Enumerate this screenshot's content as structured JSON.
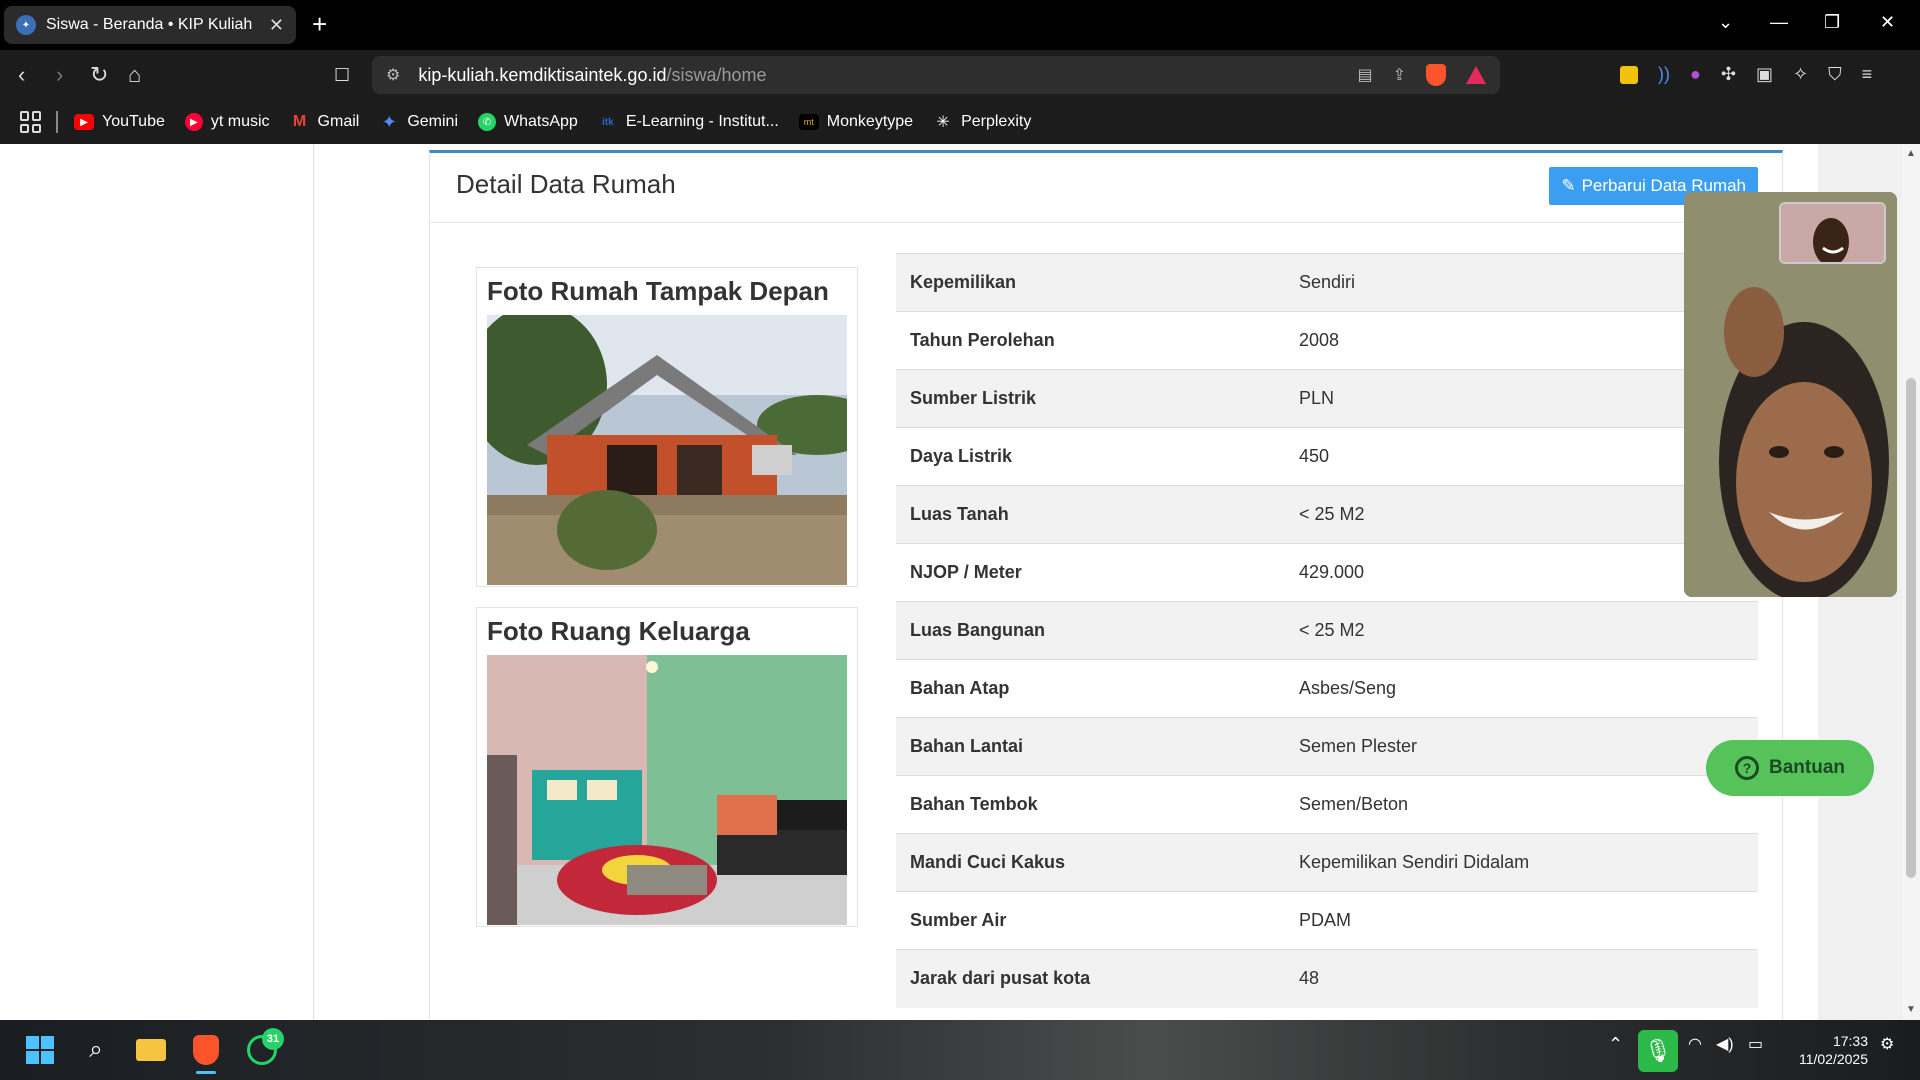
{
  "browser": {
    "tab": {
      "title": "Siswa - Beranda • KIP Kuliah",
      "close": "✕"
    },
    "new_tab": "+",
    "url_host": "kip-kuliah.kemdiktisaintek.go.id",
    "url_path": "/siswa/home",
    "bookmarks": [
      {
        "label": "YouTube",
        "icon": "youtube-icon",
        "color": "#ff0000"
      },
      {
        "label": "yt music",
        "icon": "ytmusic-icon",
        "color": "#ff0033"
      },
      {
        "label": "Gmail",
        "icon": "gmail-icon",
        "color": "#ea4335"
      },
      {
        "label": "Gemini",
        "icon": "gemini-icon",
        "color": "#4c8df6"
      },
      {
        "label": "WhatsApp",
        "icon": "whatsapp-icon",
        "color": "#25d366"
      },
      {
        "label": "E-Learning - Institut...",
        "icon": "elearning-icon",
        "color": "#1a6fd1"
      },
      {
        "label": "Monkeytype",
        "icon": "monkeytype-icon",
        "color": "#2c2e31"
      },
      {
        "label": "Perplexity",
        "icon": "perplexity-icon",
        "color": "#20808d"
      }
    ]
  },
  "card": {
    "title": "Detail Data Rumah",
    "update_button": "Perbarui Data Rumah",
    "accent": "#3c8dbc"
  },
  "photos": {
    "front": {
      "title": "Foto Rumah Tampak Depan"
    },
    "family_room": {
      "title": "Foto Ruang Keluarga"
    }
  },
  "details": [
    {
      "label": "Kepemilikan",
      "value": "Sendiri"
    },
    {
      "label": "Tahun Perolehan",
      "value": "2008"
    },
    {
      "label": "Sumber Listrik",
      "value": "PLN"
    },
    {
      "label": "Daya Listrik",
      "value": "450"
    },
    {
      "label": "Luas Tanah",
      "value": "< 25 M2"
    },
    {
      "label": "NJOP / Meter",
      "value": "429.000"
    },
    {
      "label": "Luas Bangunan",
      "value": "< 25 M2"
    },
    {
      "label": "Bahan Atap",
      "value": "Asbes/Seng"
    },
    {
      "label": "Bahan Lantai",
      "value": "Semen Plester"
    },
    {
      "label": "Bahan Tembok",
      "value": "Semen/Beton"
    },
    {
      "label": "Mandi Cuci Kakus",
      "value": "Kepemilikan Sendiri Didalam"
    },
    {
      "label": "Sumber Air",
      "value": "PDAM"
    },
    {
      "label": "Jarak dari pusat kota",
      "value": "48"
    }
  ],
  "help": {
    "label": "Bantuan"
  },
  "taskbar": {
    "whatsapp_badge": "31",
    "time": "17:33",
    "date": "11/02/2025"
  }
}
